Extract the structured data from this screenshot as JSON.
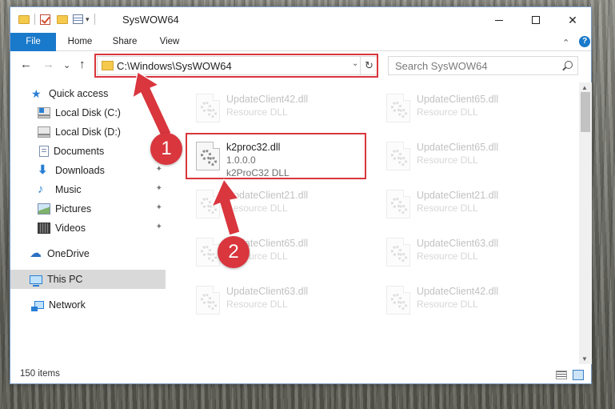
{
  "window": {
    "title": "SysWOW64",
    "minimize_icon": "minimize-icon",
    "maximize_icon": "maximize-icon",
    "close_glyph": "✕"
  },
  "ribbon": {
    "tabs": [
      "File",
      "Home",
      "Share",
      "View"
    ],
    "expand_glyph": "⌄",
    "help_glyph": "?"
  },
  "nav": {
    "back_glyph": "←",
    "forward_glyph": "→",
    "recent_glyph": "⌄",
    "up_glyph": "↑"
  },
  "address": {
    "path": "C:\\Windows\\SysWOW64",
    "dropdown_glyph": "⌄",
    "refresh_glyph": "↻"
  },
  "search": {
    "placeholder": "Search SysWOW64"
  },
  "sidebar": {
    "items": [
      {
        "label": "Quick access",
        "icon": "star-icon",
        "pinned": false
      },
      {
        "label": "Local Disk (C:)",
        "icon": "drive-c-icon",
        "pinned": false
      },
      {
        "label": "Local Disk (D:)",
        "icon": "drive-icon",
        "pinned": false
      },
      {
        "label": "Documents",
        "icon": "documents-icon",
        "pinned": false
      },
      {
        "label": "Downloads",
        "icon": "downloads-icon",
        "pinned": true
      },
      {
        "label": "Music",
        "icon": "music-icon",
        "pinned": true
      },
      {
        "label": "Pictures",
        "icon": "pictures-icon",
        "pinned": true
      },
      {
        "label": "Videos",
        "icon": "videos-icon",
        "pinned": true
      },
      {
        "label": "OneDrive",
        "icon": "cloud-icon",
        "pinned": false
      },
      {
        "label": "This PC",
        "icon": "computer-icon",
        "pinned": false,
        "selected": true
      },
      {
        "label": "Network",
        "icon": "network-icon",
        "pinned": false
      }
    ],
    "pin_glyph": "📌"
  },
  "files": {
    "left": [
      {
        "name": "UpdateClient42.dll",
        "line2": "Resource DLL",
        "line3": ""
      },
      {
        "name": "k2proc32.dll",
        "line2": "1.0.0.0",
        "line3": "k2ProC32 DLL"
      },
      {
        "name": "UpdateClient21.dll",
        "line2": "Resource DLL",
        "line3": ""
      },
      {
        "name": "UpdateClient65.dll",
        "line2": "Resource DLL",
        "line3": ""
      },
      {
        "name": "UpdateClient63.dll",
        "line2": "Resource DLL",
        "line3": ""
      }
    ],
    "right": [
      {
        "name": "UpdateClient65.dll",
        "line2": "Resource DLL",
        "line3": ""
      },
      {
        "name": "UpdateClient65.dll",
        "line2": "Resource DLL",
        "line3": ""
      },
      {
        "name": "UpdateClient21.dll",
        "line2": "Resource DLL",
        "line3": ""
      },
      {
        "name": "UpdateClient63.dll",
        "line2": "Resource DLL",
        "line3": ""
      },
      {
        "name": "UpdateClient42.dll",
        "line2": "Resource DLL",
        "line3": ""
      }
    ],
    "highlighted_file": "k2proc32.dll"
  },
  "status": {
    "item_count": "150 items"
  },
  "annotations": {
    "badge1": "1",
    "badge2": "2",
    "color": "#d9363e"
  },
  "scroll": {
    "up_glyph": "▲",
    "down_glyph": "▼"
  }
}
